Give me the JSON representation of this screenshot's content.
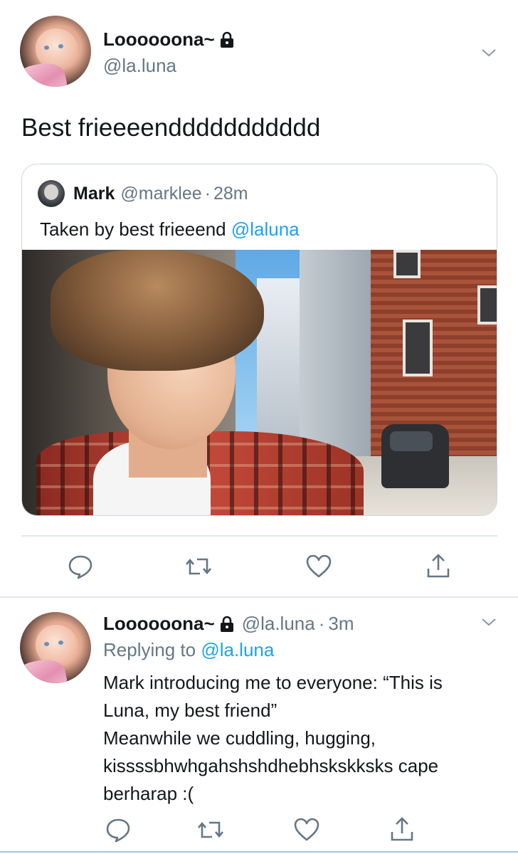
{
  "main_tweet": {
    "display_name": "Loooooona~",
    "handle": "@la.luna",
    "text": "Best frieeeenddddddddddd",
    "quote": {
      "display_name": "Mark",
      "handle": "@marklee",
      "separator": "·",
      "time": "28m",
      "text_prefix": "Taken by best frieeend ",
      "mention": "@laluna"
    }
  },
  "reply_tweet": {
    "display_name": "Loooooona~",
    "handle": "@la.luna",
    "separator": "·",
    "time": "3m",
    "replying_to_label": "Replying to ",
    "replying_to_mention": "@la.luna",
    "text_lines": [
      "Mark introducing me to everyone: “This is",
      "Luna, my best friend”",
      "Meanwhile we cuddling, hugging,",
      "kissssbhwhgahshshdhebhskskksks cape",
      "berharap :("
    ]
  },
  "icons": {
    "lock": "lock-icon",
    "chevron": "chevron-down-icon",
    "reply": "reply-icon",
    "retweet": "retweet-icon",
    "like": "heart-icon",
    "share": "share-icon"
  },
  "colors": {
    "text": "#14171a",
    "secondary": "#657786",
    "link": "#1da1f2",
    "border": "#ccd6dd",
    "icon": "#657786"
  }
}
